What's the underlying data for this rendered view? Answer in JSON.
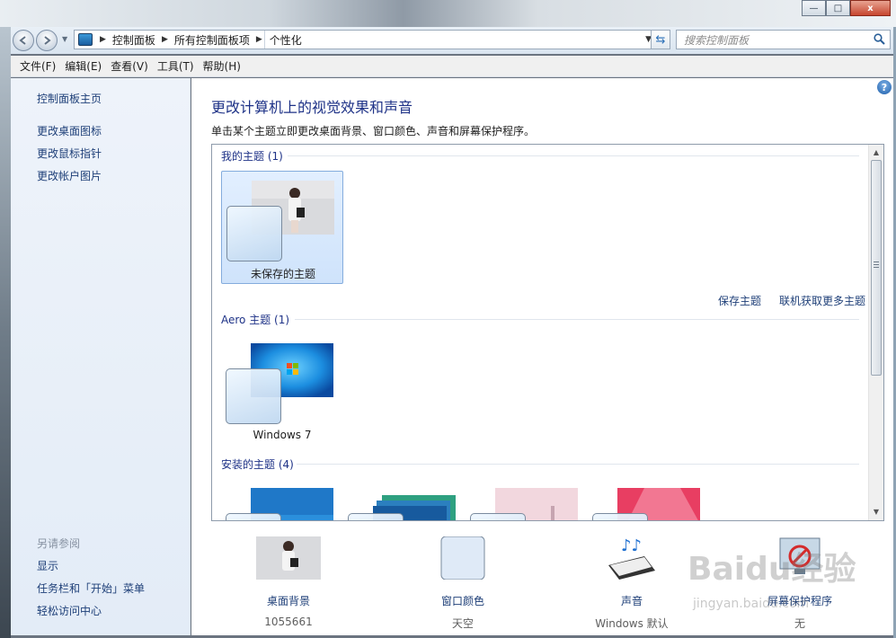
{
  "window": {
    "caption": {
      "minimize": "—",
      "maximize": "□",
      "close": "x"
    }
  },
  "address_bar": {
    "breadcrumbs": [
      "控制面板",
      "所有控制面板项",
      "个性化"
    ],
    "search_placeholder": "搜索控制面板"
  },
  "menu": [
    "文件(F)",
    "编辑(E)",
    "查看(V)",
    "工具(T)",
    "帮助(H)"
  ],
  "sidebar": {
    "links": [
      "控制面板主页",
      "更改桌面图标",
      "更改鼠标指针",
      "更改帐户图片"
    ],
    "see_also_heading": "另请参阅",
    "see_also": [
      "显示",
      "任务栏和「开始」菜单",
      "轻松访问中心"
    ]
  },
  "main": {
    "title": "更改计算机上的视觉效果和声音",
    "description": "单击某个主题立即更改桌面背景、窗口颜色、声音和屏幕保护程序。",
    "groups": {
      "my_themes": {
        "header": "我的主题 (1)",
        "items": [
          "未保存的主题"
        ]
      },
      "aero_themes": {
        "header": "Aero 主题 (1)",
        "items": [
          "Windows 7"
        ]
      },
      "installed_themes": {
        "header": "安装的主题 (4)"
      }
    },
    "links": {
      "save_theme": "保存主题",
      "get_more": "联机获取更多主题"
    },
    "help": "?"
  },
  "bottom": {
    "desktop_background": {
      "label": "桌面背景",
      "value": "1055661"
    },
    "window_color": {
      "label": "窗口颜色",
      "value": "天空"
    },
    "sounds": {
      "label": "声音",
      "value": "Windows 默认"
    },
    "screensaver": {
      "label": "屏幕保护程序",
      "value": "无"
    }
  },
  "watermark": {
    "main": "Baidu经验",
    "sub": "jingyan.baidu.com"
  },
  "colors": {
    "link": "#1e3f78",
    "title": "#1e3287",
    "selection": "#cfe3fb"
  }
}
